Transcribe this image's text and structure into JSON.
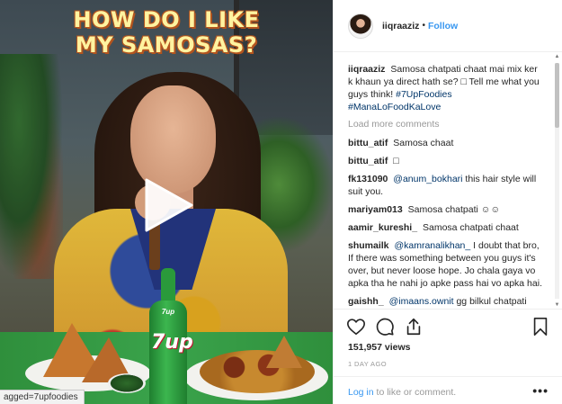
{
  "media": {
    "video_title_line1": "HOW DO I LIKE",
    "video_title_line2": "MY SAMOSAS?",
    "bottle_brand": "7up",
    "bottle_small": "7up",
    "tagged_text": "agged=7upfoodies",
    "play_icon": "play-icon"
  },
  "header": {
    "username": "iiqraaziz",
    "separator": "•",
    "follow_label": "Follow"
  },
  "caption": {
    "username": "iiqraaziz",
    "text": "Samosa chatpati chaat mai mix ker k khaun ya direct hath se? □ Tell me what you guys think!",
    "hashtags": "#7UpFoodies #ManaLoFoodKaLove"
  },
  "load_more_label": "Load more comments",
  "comments": [
    {
      "username": "bittu_atif",
      "text": "Samosa chaat"
    },
    {
      "username": "bittu_atif",
      "text": "□"
    },
    {
      "username": "fk131090",
      "mention": "@anum_bokhari",
      "text": "this hair style will suit you."
    },
    {
      "username": "mariyam013",
      "text": "Samosa chatpati ☺☺"
    },
    {
      "username": "aamir_kureshi_",
      "text": "Samosa chatpati chaat"
    },
    {
      "username": "shumailk",
      "mention": "@kamranalikhan_",
      "text": "I doubt that bro, If there was something between you guys it's over, but never loose hope. Jo chala gaya vo apka tha he nahi jo apke pass hai vo apka hai."
    },
    {
      "username": "gaishh_",
      "mention": "@imaans.ownit",
      "text": "gg bilkul chatpati chaat mai mix karke☺☺"
    }
  ],
  "actions": {
    "like_icon": "heart-icon",
    "comment_icon": "comment-icon",
    "share_icon": "share-icon",
    "save_icon": "bookmark-icon"
  },
  "views": "151,957 views",
  "time": "1 DAY AGO",
  "footer": {
    "login_link": "Log in",
    "login_rest": "to like or comment.",
    "more": "•••"
  },
  "colors": {
    "link_blue": "#3897f0",
    "hashtag_blue": "#003569",
    "muted": "#999999",
    "text": "#262626",
    "title_yellow": "#fff3a0"
  }
}
